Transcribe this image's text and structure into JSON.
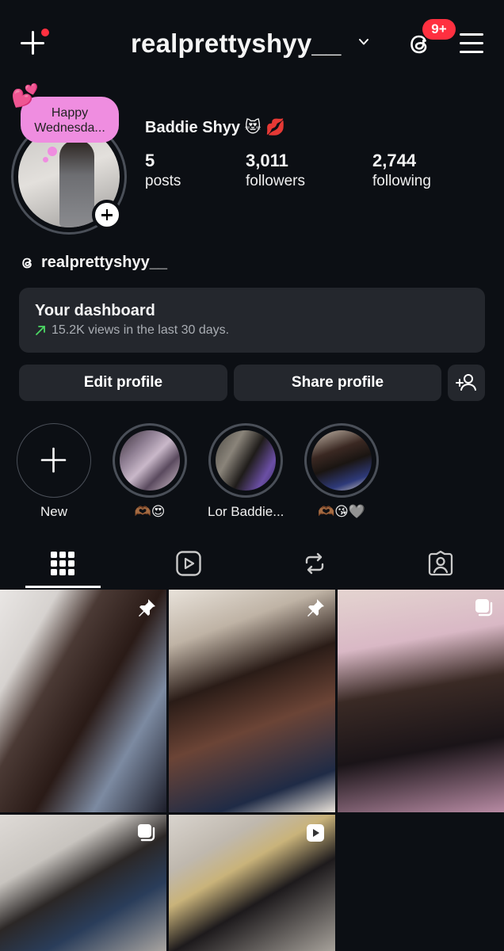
{
  "header": {
    "username": "realprettyshyy__",
    "notification_badge": "9+",
    "colors": {
      "badge": "#ff3040",
      "background": "#0c0f14"
    }
  },
  "profile": {
    "note_text": "Happy Wednesda...",
    "note_emoji": "💕",
    "display_name": "Baddie Shyy 😻 💋",
    "stats": [
      {
        "number": "5",
        "label": "posts"
      },
      {
        "number": "3,011",
        "label": "followers"
      },
      {
        "number": "2,744",
        "label": "following"
      }
    ],
    "threads_handle": "realprettyshyy__"
  },
  "dashboard": {
    "title": "Your dashboard",
    "subtitle": "15.2K views in the last 30 days.",
    "arrow_icon": "trend-up-icon"
  },
  "buttons": {
    "edit_profile": "Edit profile",
    "share_profile": "Share profile",
    "add_person_icon": "add-person-icon"
  },
  "highlights": [
    {
      "label": "New"
    },
    {
      "label": "🫶🏾😍"
    },
    {
      "label": "Lor Baddie..."
    },
    {
      "label": "🫶🏾😘🩶"
    }
  ],
  "tabs": [
    "grid-icon",
    "reels-icon",
    "reposts-icon",
    "tagged-icon"
  ],
  "posts": [
    {
      "icon": "pin-icon"
    },
    {
      "icon": "pin-icon"
    },
    {
      "icon": "carousel-icon"
    },
    {
      "icon": "carousel-icon"
    },
    {
      "icon": "reel-icon"
    }
  ]
}
